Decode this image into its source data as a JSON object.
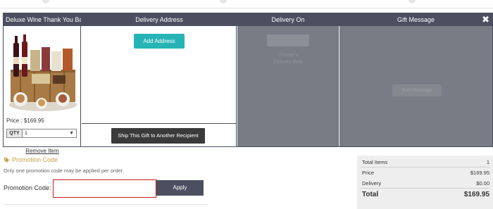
{
  "table": {
    "headers": {
      "product": "Deluxe Wine Thank You Baske",
      "address": "Delivery Address",
      "delivery": "Delivery On",
      "gift": "Gift Message"
    },
    "close_symbol": "✖"
  },
  "product": {
    "price": "Price : $169.95",
    "qty_label": "QTY",
    "qty_value": "1",
    "remove_label": "Remove Item"
  },
  "address": {
    "add_button": "Add Address",
    "ship_button": "Ship This Gift to Another Recipient"
  },
  "delivery": {
    "choose_date_text_1": "Choose a",
    "choose_date_text_2": "Delivery date"
  },
  "gift": {
    "add_message_button": "Add Message"
  },
  "promotion": {
    "title": "Promotion Code",
    "note": "Only one promotion code may be applied per order.",
    "label": "Promotion Code:",
    "input_value": "",
    "apply_button": "Apply"
  },
  "summary": {
    "total_items_label": "Total Items",
    "total_items_value": "1",
    "price_label": "Price",
    "price_value": "$169.95",
    "delivery_label": "Delivery",
    "delivery_value": "$0.00",
    "total_label": "Total",
    "total_value": "$169.95"
  },
  "colors": {
    "header_bg": "#4b4f60",
    "teal_button": "#26b3b6",
    "promo_accent": "#c9a14a",
    "input_error_border": "#d01818",
    "overlay": "#787c85"
  },
  "icons": {
    "close": "close-icon",
    "tag": "tag-icon",
    "dropdown": "chevron-down-icon"
  }
}
